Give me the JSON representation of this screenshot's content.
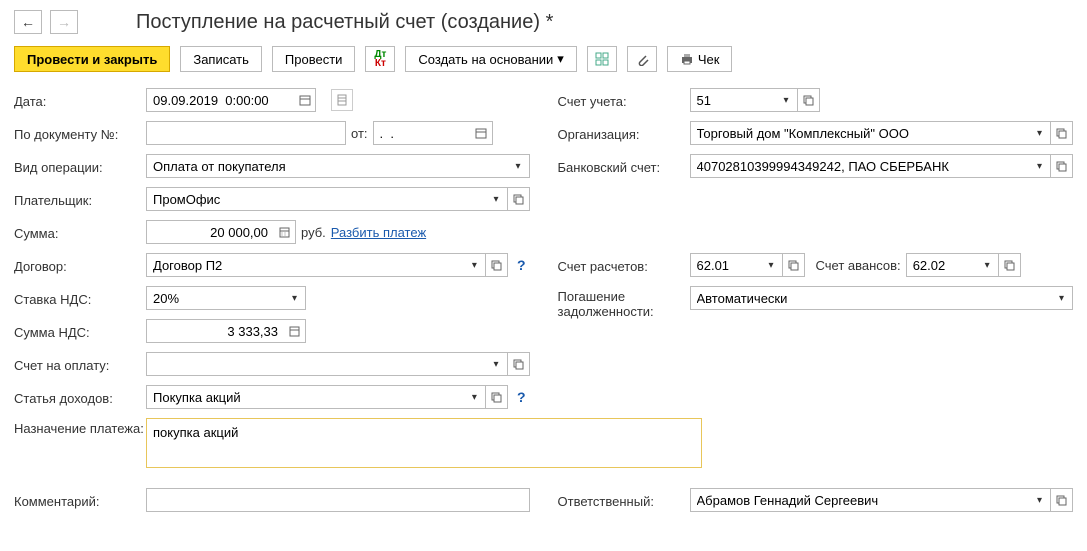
{
  "nav": {
    "back": "←",
    "fwd": "→"
  },
  "title": "Поступление на расчетный счет (создание) *",
  "toolbar": {
    "post_close": "Провести и закрыть",
    "save": "Записать",
    "post": "Провести",
    "create_basis": "Создать на основании",
    "cheque": "Чек"
  },
  "labels": {
    "date": "Дата:",
    "doc_no": "По документу №:",
    "ot": "от:",
    "op_type": "Вид операции:",
    "payer": "Плательщик:",
    "sum": "Сумма:",
    "rub": "руб.",
    "split": "Разбить платеж",
    "contract": "Договор:",
    "vat_rate": "Ставка НДС:",
    "vat_sum": "Сумма НДС:",
    "invoice": "Счет на оплату:",
    "income_item": "Статья доходов:",
    "purpose": "Назначение платежа:",
    "comment": "Комментарий:",
    "account": "Счет учета:",
    "org": "Организация:",
    "bank_acc": "Банковский счет:",
    "settle_acc": "Счет расчетов:",
    "advance_acc": "Счет авансов:",
    "debt": "Погашение задолженности:",
    "responsible": "Ответственный:"
  },
  "values": {
    "date": "09.09.2019  0:00:00",
    "doc_no": "",
    "ot": ".  .",
    "op_type": "Оплата от покупателя",
    "payer": "ПромОфис",
    "sum": "20 000,00",
    "contract": "Договор П2",
    "vat_rate": "20%",
    "vat_sum": "3 333,33",
    "invoice": "",
    "income_item": "Покупка акций",
    "purpose": "покупка акций",
    "comment": "",
    "account": "51",
    "org": "Торговый дом \"Комплексный\" ООО",
    "bank_acc": "40702810399994349242, ПАО СБЕРБАНК",
    "settle_acc": "62.01",
    "advance_acc": "62.02",
    "debt": "Автоматически",
    "responsible": "Абрамов Геннадий Сергеевич"
  },
  "glyph": {
    "down": "▾",
    "cal": "📅",
    "ext": "⧉",
    "calc": "🖩",
    "help": "?"
  }
}
